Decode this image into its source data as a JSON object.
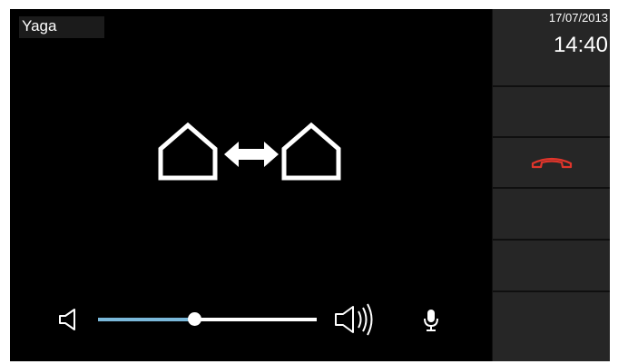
{
  "caller": {
    "name": "Yaga"
  },
  "clock": {
    "date": "17/07/2013",
    "time": "14:40"
  },
  "volume": {
    "level": 0.44
  },
  "icons": {
    "call_status": "house-to-house-intercom-icon",
    "volume_low": "speaker-low-icon",
    "volume_high": "speaker-high-icon",
    "microphone": "microphone-icon",
    "hangup": "hang-up-phone-icon"
  },
  "colors": {
    "background": "#000000",
    "sidebar": "#262626",
    "slider_fill": "#7ab8da",
    "hangup": "#e0352b"
  }
}
